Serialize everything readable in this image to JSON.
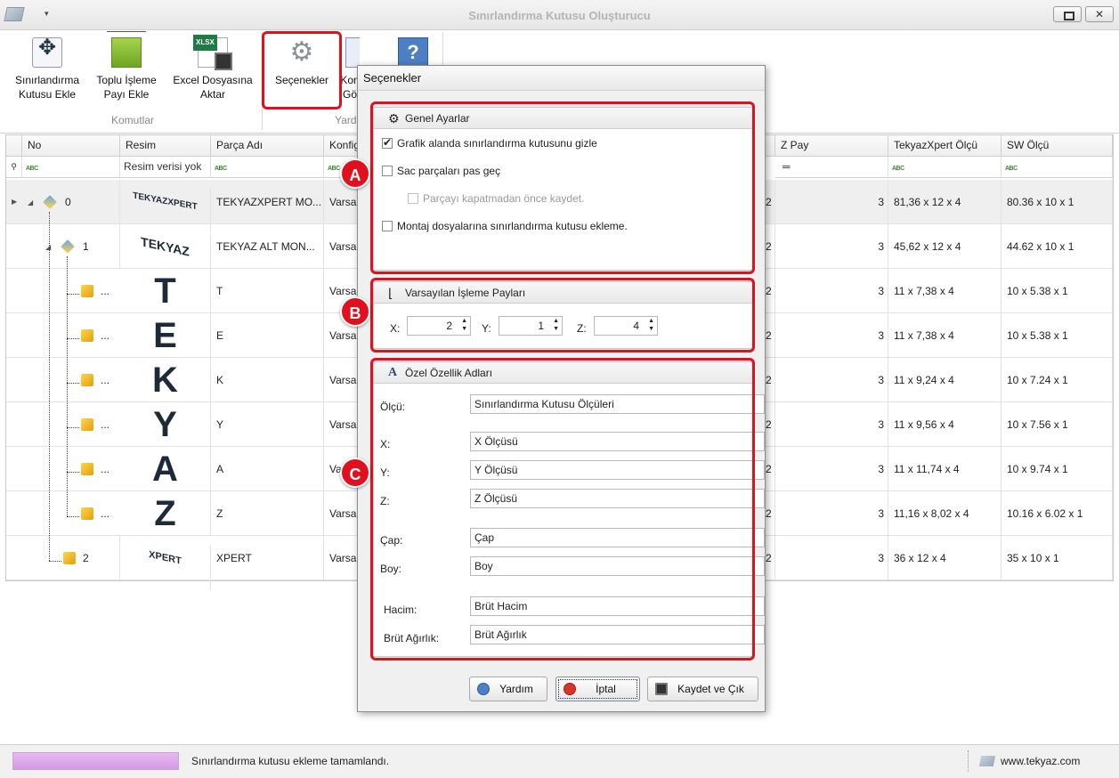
{
  "window": {
    "title": "Sınırlandırma Kutusu Oluşturucu",
    "quick_access": "▾"
  },
  "ribbon": {
    "buttons": [
      {
        "label1": "Sınırlandırma",
        "label2": "Kutusu Ekle"
      },
      {
        "label1": "Toplu İşleme",
        "label2": "Payı Ekle"
      },
      {
        "label1": "Excel Dosyasına",
        "label2": "Aktar"
      },
      {
        "label1": "Seçenekler",
        "label2": ""
      },
      {
        "label1": "Kon",
        "label2": "Gö"
      }
    ],
    "groups": [
      "Komutlar",
      "Yardı"
    ]
  },
  "grid": {
    "columns": [
      "No",
      "Resim",
      "Parça Adı",
      "Konfig",
      "Z Pay",
      "TekyazXpert Ölçü",
      "SW Ölçü"
    ],
    "filter": {
      "resim": "Resim verisi yok",
      "z_pay": "═",
      "abc": "ABC"
    },
    "rows": [
      {
        "no": "0",
        "pic": "TEKYAZXPERT",
        "name": "TEKYAZXPERT MO...",
        "konfig": "Varsa",
        "zpay": "3",
        "xpert": "81,36 x 12 x 4",
        "sw": "80.36 x 10 x 1"
      },
      {
        "no": "1",
        "pic": "TEKYAZ",
        "name": "TEKYAZ ALT MON...",
        "konfig": "Varsa",
        "zpay": "3",
        "xpert": "45,62 x 12 x 4",
        "sw": "44.62 x 10 x 1"
      },
      {
        "no": "...",
        "pic": "T",
        "name": "T",
        "konfig": "Varsa",
        "zpay": "3",
        "xpert": "11 x 7,38 x 4",
        "sw": "10 x 5.38 x 1"
      },
      {
        "no": "...",
        "pic": "E",
        "name": "E",
        "konfig": "Varsa",
        "zpay": "3",
        "xpert": "11 x 7,38 x 4",
        "sw": "10 x 5.38 x 1"
      },
      {
        "no": "...",
        "pic": "K",
        "name": "K",
        "konfig": "Varsa",
        "zpay": "3",
        "xpert": "11 x 9,24 x 4",
        "sw": "10 x 7.24 x 1"
      },
      {
        "no": "...",
        "pic": "Y",
        "name": "Y",
        "konfig": "Varsa",
        "zpay": "3",
        "xpert": "11 x 9,56 x 4",
        "sw": "10 x 7.56 x 1"
      },
      {
        "no": "...",
        "pic": "A",
        "name": "A",
        "konfig": "Varsa",
        "zpay": "3",
        "xpert": "11 x 11,74 x 4",
        "sw": "10 x 9.74 x 1"
      },
      {
        "no": "...",
        "pic": "Z",
        "name": "Z",
        "konfig": "Varsa",
        "zpay": "3",
        "xpert": "11,16 x 8,02 x 4",
        "sw": "10.16 x 6.02 x 1"
      },
      {
        "no": "2",
        "pic": "XPERT",
        "name": "XPERT",
        "konfig": "Varsa",
        "zpay": "3",
        "xpert": "36 x 12 x 4",
        "sw": "35 x 10 x 1"
      }
    ],
    "hidden_y_pay": "2"
  },
  "status": {
    "text": "Sınırlandırma kutusu ekleme tamamlandı.",
    "website": "www.tekyaz.com",
    "progress_color": "#d9a2ea"
  },
  "dialog": {
    "title": "Seçenekler",
    "general": {
      "title": "Genel Ayarlar",
      "hide_box": "Grafik alanda sınırlandırma kutusunu gizle",
      "skip_sheet": "Sac parçaları pas geç",
      "save_before_close": "Parçayı kapatmadan önce kaydet.",
      "no_assembly": "Montaj dosyalarına sınırlandırma kutusu ekleme."
    },
    "padding": {
      "title": "Varsayılan İşleme Payları",
      "x_label": "X:",
      "x": "2",
      "y_label": "Y:",
      "y": "1",
      "z_label": "Z:",
      "z": "4"
    },
    "props": {
      "title": "Özel Özellik Adları",
      "olcu_label": "Ölçü:",
      "olcu": "Sınırlandırma Kutusu Ölçüleri",
      "x_label": "X:",
      "x": "X Ölçüsü",
      "y_label": "Y:",
      "y": "Y Ölçüsü",
      "z_label": "Z:",
      "z": "Z Ölçüsü",
      "cap_label": "Çap:",
      "cap": "Çap",
      "boy_label": "Boy:",
      "boy": "Boy",
      "hacim_label": "Hacim:",
      "hacim": "Brüt Hacim",
      "agirlik_label": "Brüt Ağırlık:",
      "agirlik": "Brüt Ağırlık"
    },
    "buttons": {
      "help": "Yardım",
      "cancel": "İptal",
      "save": "Kaydet ve Çık"
    }
  },
  "annotations": {
    "a": "A",
    "b": "B",
    "c": "C",
    "color": "#e0101e"
  }
}
